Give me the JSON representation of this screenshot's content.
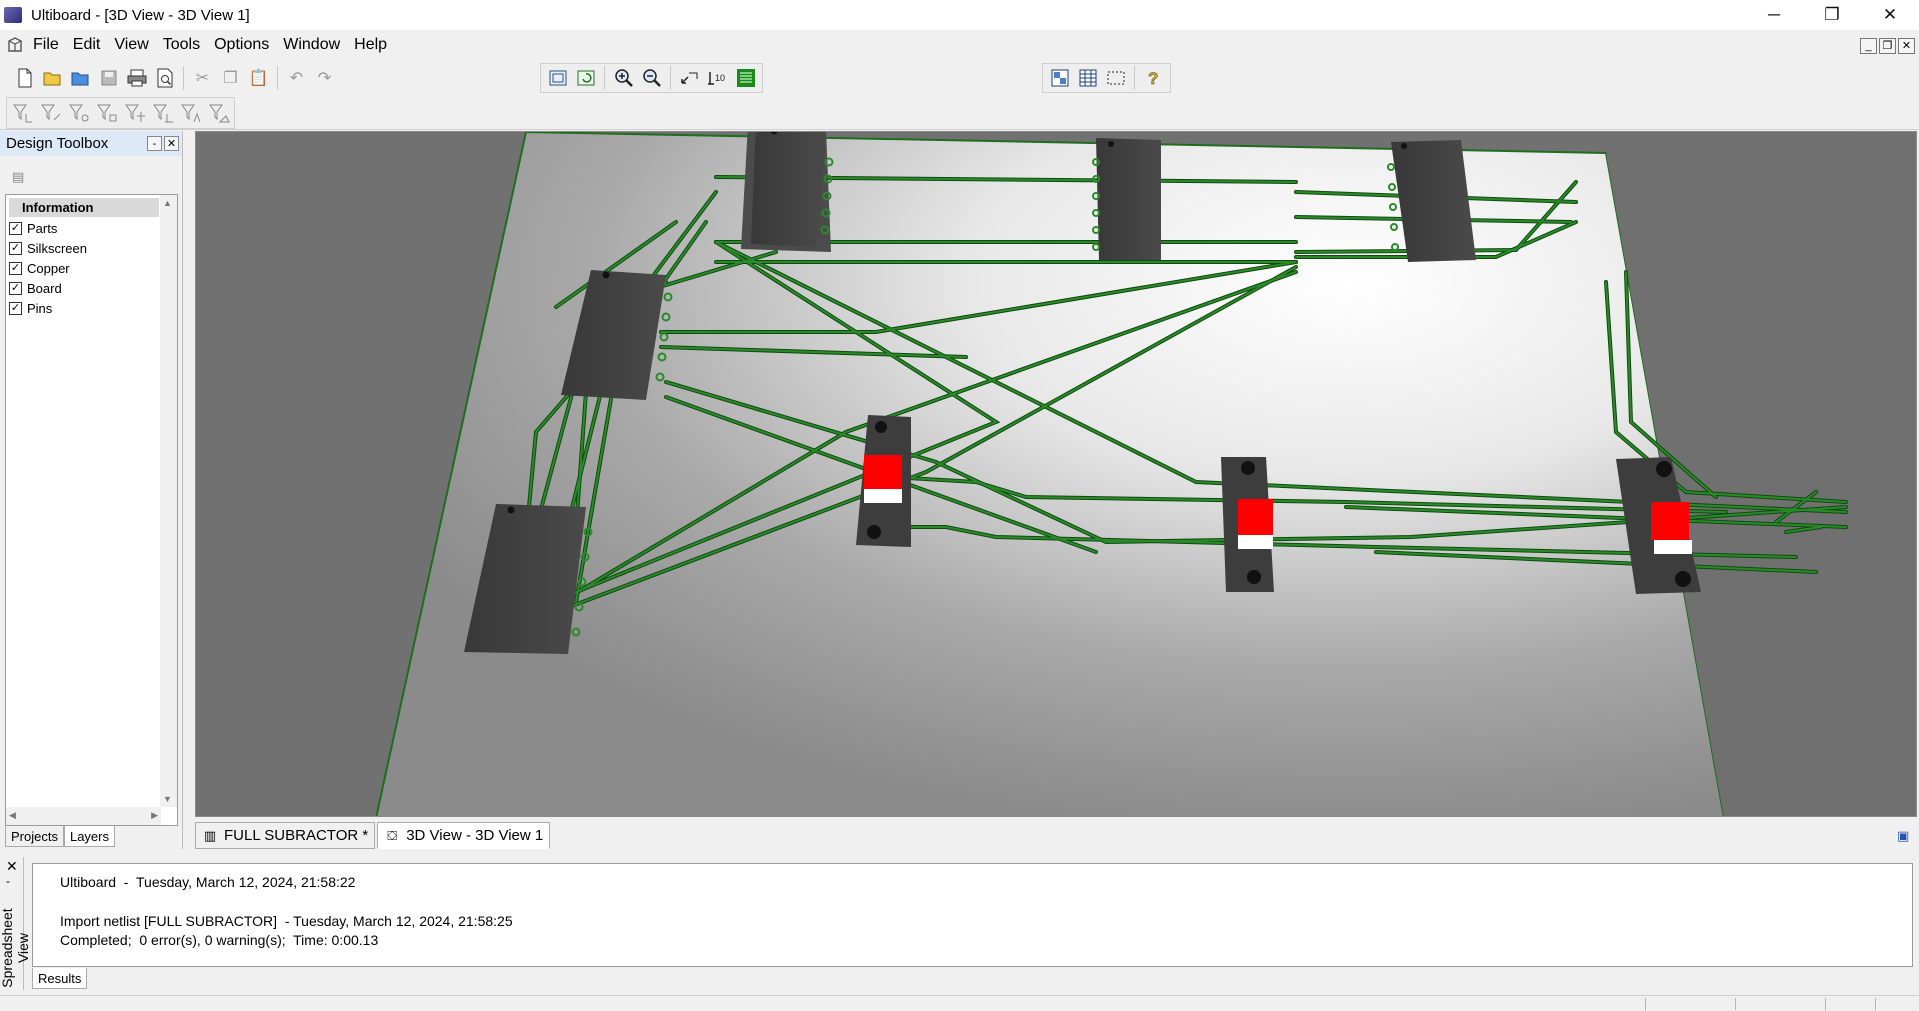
{
  "window": {
    "title": "Ultiboard - [3D View - 3D View 1]",
    "controls": [
      "─",
      "❐",
      "✕"
    ]
  },
  "menu": {
    "items": [
      "File",
      "Edit",
      "View",
      "Tools",
      "Options",
      "Window",
      "Help"
    ],
    "mdi_controls": [
      "_",
      "❐",
      "✕"
    ]
  },
  "toolbox": {
    "title": "Design Toolbox",
    "pin_label": "-",
    "close_label": "✕",
    "group": "Information",
    "layers": [
      {
        "label": "Parts",
        "checked": true
      },
      {
        "label": "Silkscreen",
        "checked": true
      },
      {
        "label": "Copper",
        "checked": true
      },
      {
        "label": "Board",
        "checked": true
      },
      {
        "label": "Pins",
        "checked": true
      }
    ],
    "check_mark": "✓",
    "tabs": [
      "Projects",
      "Layers"
    ],
    "active_tab": "Layers"
  },
  "doc_tabs": [
    {
      "label": "FULL SUBRACTOR *",
      "icon": "chip-icon",
      "active": false
    },
    {
      "label": "3D View - 3D View 1",
      "icon": "3d-view-icon",
      "active": true
    }
  ],
  "spreadsheet": {
    "label": "Spreadsheet View",
    "close_label": "✕",
    "results_tab": "Results",
    "lines": [
      "Ultiboard  -  Tuesday, March 12, 2024, 21:58:22",
      "",
      "Import netlist [FULL SUBRACTOR]  - Tuesday, March 12, 2024, 21:58:25",
      "Completed;  0 error(s), 0 warning(s);  Time: 0:00.13"
    ]
  },
  "colors": {
    "trace": "#2a8a2a",
    "trace_dark": "#0f4a0f",
    "chip_body": "#404040",
    "switch_red": "#ff0000",
    "silkscreen": "#e8e84a",
    "board_outline": "#1f6d1f"
  }
}
